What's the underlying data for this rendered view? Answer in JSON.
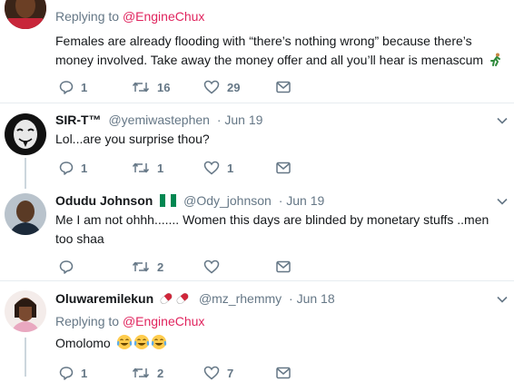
{
  "tweets": [
    {
      "replying_prefix": "Replying to",
      "replying_handle": "@EngineChux",
      "text": "Females are already flooding with “there’s nothing wrong” because there’s money involved. Take away the money offer and all you’ll hear is menascum",
      "emoji": "runner",
      "reply_count": "1",
      "retweet_count": "16",
      "like_count": "29"
    },
    {
      "name": "SIR-T™",
      "handle": "@yemiwastephen",
      "date": "· Jun 19",
      "text": "Lol...are you surprise thou?",
      "reply_count": "1",
      "retweet_count": "1",
      "like_count": "1"
    },
    {
      "name": "Odudu Johnson",
      "flag": "nigeria-flag",
      "handle": "@Ody_johnson",
      "date": "· Jun 19",
      "text": "Me I am not ohhh....... Women this days are blinded by monetary stuffs ..men too shaa",
      "reply_count": "",
      "retweet_count": "2",
      "like_count": ""
    },
    {
      "name": "Oluwaremilekun",
      "name_emoji": "pill-pill",
      "handle": "@mz_rhemmy",
      "date": "· Jun 18",
      "replying_prefix": "Replying to",
      "replying_handle": "@EngineChux",
      "text": "Omolomo",
      "text_emoji": "tears-of-joy x3",
      "reply_count": "1",
      "retweet_count": "2",
      "like_count": "7"
    }
  ],
  "colors": {
    "link": "#e0245e",
    "muted": "#657786",
    "text": "#14171a",
    "line": "#ccd6dd"
  }
}
